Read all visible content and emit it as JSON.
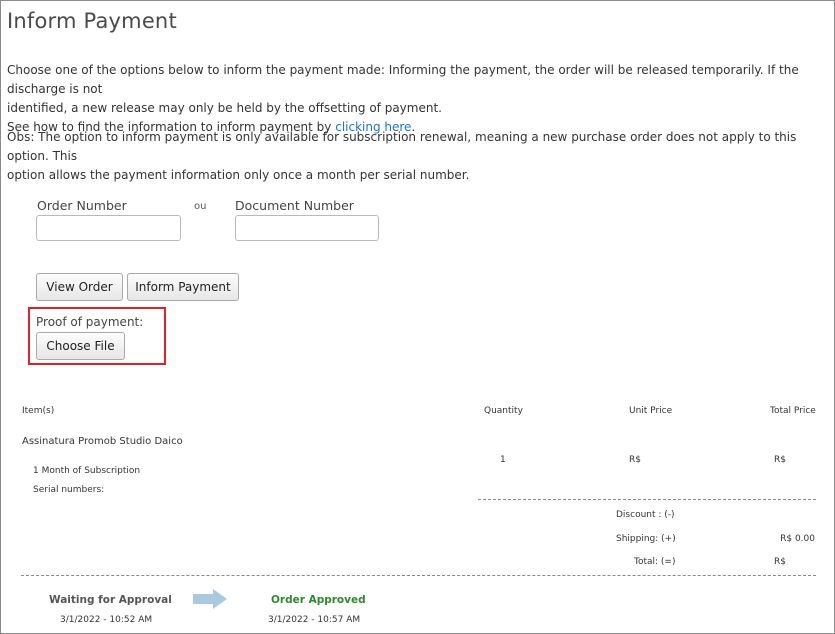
{
  "page_title": "Inform Payment",
  "intro": {
    "line1": "Choose one of the options below to inform the payment made: Informing the payment, the order will be released temporarily. If the discharge is not",
    "line2": "identified, a new release may only be held by the offsetting of payment.",
    "line3_prefix": "See how to find the information to inform payment by ",
    "line3_link": "clicking here",
    "line3_suffix": ".",
    "obs_line1": "Obs: The option to inform payment is only available for subscription renewal, meaning a new purchase order does not apply to this option. This",
    "obs_line2": "option allows the payment information only once a month per serial number."
  },
  "form": {
    "order_number_label": "Order Number",
    "or_label": "ou",
    "document_number_label": "Document Number",
    "order_number_value": "",
    "document_number_value": "",
    "view_order_button": "View Order",
    "inform_payment_button": "Inform Payment",
    "proof_label": "Proof of payment:",
    "choose_file_button": "Choose File"
  },
  "table": {
    "headers": {
      "items": "Item(s)",
      "quantity": "Quantity",
      "unit_price": "Unit Price",
      "total_price": "Total Price"
    },
    "item_name": "Assinatura Promob Studio Daico",
    "item_detail": "1 Month of Subscription",
    "serial_label": "Serial numbers:",
    "quantity": "1",
    "unit_price": "R$",
    "total_price": "R$"
  },
  "totals": {
    "discount_label": "Discount : (-)",
    "discount_value": "",
    "shipping_label": "Shipping: (+)",
    "shipping_value": "R$ 0.00",
    "total_label": "Total: (=)",
    "total_value": "R$"
  },
  "status": {
    "step1_label": "Waiting for Approval",
    "step1_date": "3/1/2022 - 10:52 AM",
    "step2_label": "Order Approved",
    "step2_date": "3/1/2022 - 10:57 AM",
    "arrow_icon": "arrow-right-icon",
    "approved_color": "#2b8a2b"
  }
}
